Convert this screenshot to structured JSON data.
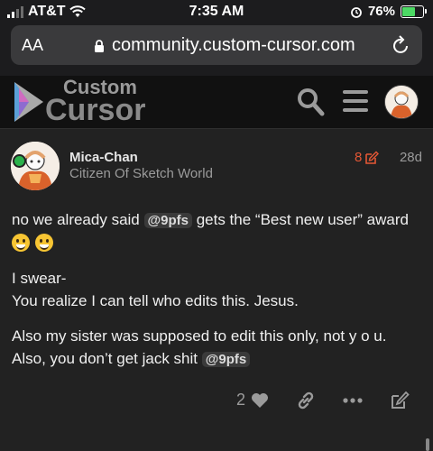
{
  "status": {
    "carrier": "AT&T",
    "time": "7:35 AM",
    "battery": "76%",
    "battery_level": 0.76
  },
  "browser": {
    "text_size_label": "AA",
    "url": "community.custom-cursor.com"
  },
  "site": {
    "logo_line1": "Custom",
    "logo_line2": "Cursor"
  },
  "post": {
    "username": "Mica-Chan",
    "user_title": "Citizen Of Sketch World",
    "edit_count": "8",
    "age": "28d",
    "paragraph1_a": "no we already said",
    "paragraph1_mention": "@9pfs",
    "paragraph1_b": "gets the “Best new user” award",
    "paragraph2_line1": "I swear-",
    "paragraph2_line2": "You realize I can tell who edits this. Jesus.",
    "paragraph3_line1": "Also my sister was supposed to edit this only, not y o u.",
    "paragraph3_line2": "Also, you don’t get jack shit",
    "paragraph3_mention": "@9pfs",
    "like_count": "2"
  },
  "colors": {
    "accent": "#e45735",
    "background": "#222222",
    "header": "#111111",
    "online": "#2bb24c"
  },
  "icons": [
    "signal-icon",
    "wifi-icon",
    "alarm-icon",
    "battery-icon",
    "lock-icon",
    "reload-icon",
    "search-icon",
    "hamburger-menu-icon",
    "heart-icon",
    "link-icon",
    "more-icon",
    "edit-icon",
    "pencil-icon"
  ]
}
